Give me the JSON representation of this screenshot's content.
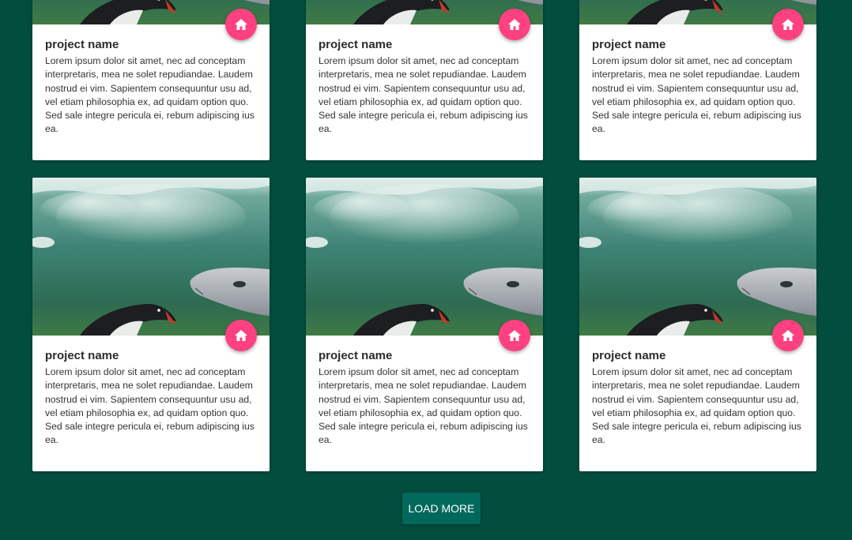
{
  "cards": [
    {
      "title": "project name",
      "description": "Lorem ipsum dolor sit amet, nec ad conceptam interpretaris, mea ne solet repudiandae. Laudem nostrud ei vim. Sapientem consequuntur usu ad, vel etiam philosophia ex, ad quidam option quo. Sed sale integre pericula ei, rebum adipiscing ius ea.",
      "icon": "home-icon"
    },
    {
      "title": "project name",
      "description": "Lorem ipsum dolor sit amet, nec ad conceptam interpretaris, mea ne solet repudiandae. Laudem nostrud ei vim. Sapientem consequuntur usu ad, vel etiam philosophia ex, ad quidam option quo. Sed sale integre pericula ei, rebum adipiscing ius ea.",
      "icon": "home-icon"
    },
    {
      "title": "project name",
      "description": "Lorem ipsum dolor sit amet, nec ad conceptam interpretaris, mea ne solet repudiandae. Laudem nostrud ei vim. Sapientem consequuntur usu ad, vel etiam philosophia ex, ad quidam option quo. Sed sale integre pericula ei, rebum adipiscing ius ea.",
      "icon": "home-icon"
    },
    {
      "title": "project name",
      "description": "Lorem ipsum dolor sit amet, nec ad conceptam interpretaris, mea ne solet repudiandae. Laudem nostrud ei vim. Sapientem consequuntur usu ad, vel etiam philosophia ex, ad quidam option quo. Sed sale integre pericula ei, rebum adipiscing ius ea.",
      "icon": "home-icon"
    },
    {
      "title": "project name",
      "description": "Lorem ipsum dolor sit amet, nec ad conceptam interpretaris, mea ne solet repudiandae. Laudem nostrud ei vim. Sapientem consequuntur usu ad, vel etiam philosophia ex, ad quidam option quo. Sed sale integre pericula ei, rebum adipiscing ius ea.",
      "icon": "home-icon"
    },
    {
      "title": "project name",
      "description": "Lorem ipsum dolor sit amet, nec ad conceptam interpretaris, mea ne solet repudiandae. Laudem nostrud ei vim. Sapientem consequuntur usu ad, vel etiam philosophia ex, ad quidam option quo. Sed sale integre pericula ei, rebum adipiscing ius ea.",
      "icon": "home-icon"
    }
  ],
  "load_more_label": "LOAD MORE",
  "colors": {
    "page_background": "#024d3e",
    "card_background": "#ffffff",
    "fab_accent": "#ff4081",
    "button_background": "#00695c"
  }
}
